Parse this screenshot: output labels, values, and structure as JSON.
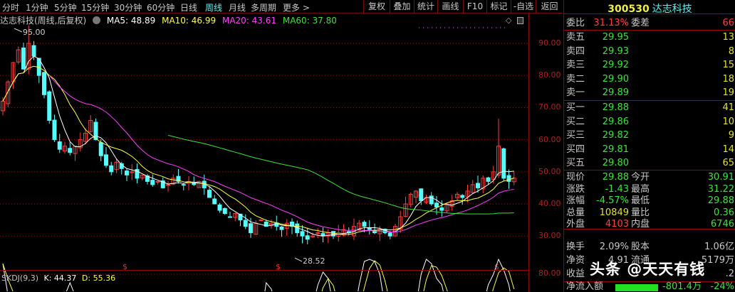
{
  "toolbar": {
    "tabs": [
      "分时",
      "1分钟",
      "5分钟",
      "15分钟",
      "30分钟",
      "60分钟",
      "日线",
      "周线",
      "月线",
      "多周期",
      "更多 >"
    ],
    "active_tab": "周线",
    "buttons": [
      "复权",
      "叠加",
      "统计",
      "画线",
      "F10",
      "标记",
      "-自选",
      "返回"
    ]
  },
  "legend": {
    "title": "达志科技(周线,后复权)",
    "ma5": "MA5: 48.89",
    "ma10": "MA10: 46.99",
    "ma20": "MA20: 43.61",
    "ma60": "MA60: 37.80"
  },
  "colors": {
    "up": "#ff3c3c",
    "down": "#54fcfc",
    "ma5": "#ffffff",
    "ma10": "#ffff40",
    "ma20": "#ff40ff",
    "ma60": "#40e040",
    "grid": "#8a1010"
  },
  "chart_data": {
    "type": "candlestick",
    "title": "达志科技(周线,后复权)",
    "y_ticks": [
      "90.00",
      "80.00",
      "70.00",
      "60.00",
      "50.00",
      "40.00",
      "30.00"
    ],
    "ylim": [
      25,
      95
    ],
    "high_label": "95.00",
    "low_label": "28.52",
    "closes": [
      72,
      78,
      84,
      88,
      82,
      90,
      86,
      80,
      74,
      66,
      60,
      57,
      58,
      56,
      58,
      60,
      62,
      66,
      60,
      55,
      52,
      50,
      53,
      51,
      49,
      50,
      48,
      49,
      47,
      46,
      47,
      45,
      46,
      48,
      47,
      46,
      47,
      46,
      47,
      45,
      42,
      40,
      38,
      37,
      36,
      37,
      35,
      33,
      31,
      34,
      35,
      33,
      34,
      33,
      32,
      34,
      33,
      31,
      30,
      29,
      30,
      31,
      30,
      31,
      30,
      31,
      32,
      31,
      33,
      34,
      33,
      32,
      31,
      32,
      31,
      30,
      33,
      36,
      40,
      43,
      44,
      41,
      42,
      40,
      39,
      38,
      40,
      41,
      43,
      42,
      44,
      46,
      45,
      48,
      47,
      50,
      58,
      48,
      47,
      48
    ],
    "indicator": {
      "name": "SKDJ(9,3)",
      "k_label": "K: 44.37",
      "d_label": "D: 55.36",
      "y_tick": "80.00",
      "k": [
        90,
        60,
        40,
        30,
        40,
        30,
        20,
        20,
        20,
        30,
        40,
        50,
        60,
        72,
        60,
        40,
        30,
        30,
        20,
        20,
        20,
        20,
        20,
        30,
        30,
        20,
        20,
        20,
        20,
        20,
        20,
        20,
        20,
        20,
        20,
        20,
        20,
        20,
        20,
        20,
        20,
        20,
        20,
        20,
        20,
        20,
        20,
        20,
        20,
        20,
        40,
        72,
        66,
        50,
        40,
        30,
        20,
        20,
        20,
        30,
        50,
        70,
        82,
        76,
        50,
        30,
        20,
        20,
        40,
        70,
        92,
        94,
        92,
        80,
        50,
        30,
        20,
        20,
        20,
        30,
        50,
        80,
        94,
        90,
        76,
        70,
        50,
        40,
        30,
        20,
        20,
        20,
        30,
        50,
        70,
        80,
        94,
        84,
        70,
        44
      ]
    },
    "markers": [
      "$",
      "$",
      "$"
    ]
  },
  "quote": {
    "code": "300530",
    "name": "达志科技",
    "wb": {
      "label": "委比",
      "value": "31.13%",
      "label2": "委差",
      "value2": "66"
    },
    "asks": [
      {
        "label": "卖五",
        "price": "29.95",
        "vol": "13"
      },
      {
        "label": "卖四",
        "price": "29.93",
        "vol": "8"
      },
      {
        "label": "卖三",
        "price": "29.92",
        "vol": "15"
      },
      {
        "label": "卖二",
        "price": "29.90",
        "vol": "18"
      },
      {
        "label": "卖一",
        "price": "29.89",
        "vol": "19"
      }
    ],
    "bids": [
      {
        "label": "买一",
        "price": "29.88",
        "vol": "41"
      },
      {
        "label": "买二",
        "price": "29.86",
        "vol": "10"
      },
      {
        "label": "买三",
        "price": "29.82",
        "vol": "9"
      },
      {
        "label": "买四",
        "price": "29.81",
        "vol": "14"
      },
      {
        "label": "买五",
        "price": "29.80",
        "vol": "65"
      }
    ],
    "stats": [
      {
        "l": "现价",
        "v": "29.88",
        "vc": "g",
        "l2": "今开",
        "v2": "30.91",
        "v2c": "g"
      },
      {
        "l": "涨跌",
        "v": "-1.43",
        "vc": "g",
        "l2": "最高",
        "v2": "31.22",
        "v2c": "g"
      },
      {
        "l": "涨幅",
        "v": "-4.57%",
        "vc": "g",
        "l2": "最低",
        "v2": "29.88",
        "v2c": "g"
      },
      {
        "l": "总量",
        "v": "10849",
        "vc": "y",
        "l2": "量比",
        "v2": "0.36",
        "v2c": "g"
      },
      {
        "l": "外盘",
        "v": "4103",
        "vc": "r",
        "l2": "内盘",
        "v2": "6746",
        "v2c": "g"
      }
    ],
    "fin": [
      {
        "l": "换手",
        "v": "2.09%",
        "vc": "w",
        "l2": "股本",
        "v2": "1.06亿",
        "v2c": "w"
      },
      {
        "l": "净资",
        "v": "4.91",
        "vc": "w",
        "l2": "流通",
        "v2": "5179万",
        "v2c": "w"
      },
      {
        "l": "收益",
        "v": "",
        "vc": "w",
        "l2": "",
        "v2": ".2",
        "v2c": "w"
      }
    ],
    "flow": {
      "label": "净流入额",
      "value": "-801.4万",
      "pct": "-24%"
    }
  },
  "watermark": "头条 @天天有钱"
}
